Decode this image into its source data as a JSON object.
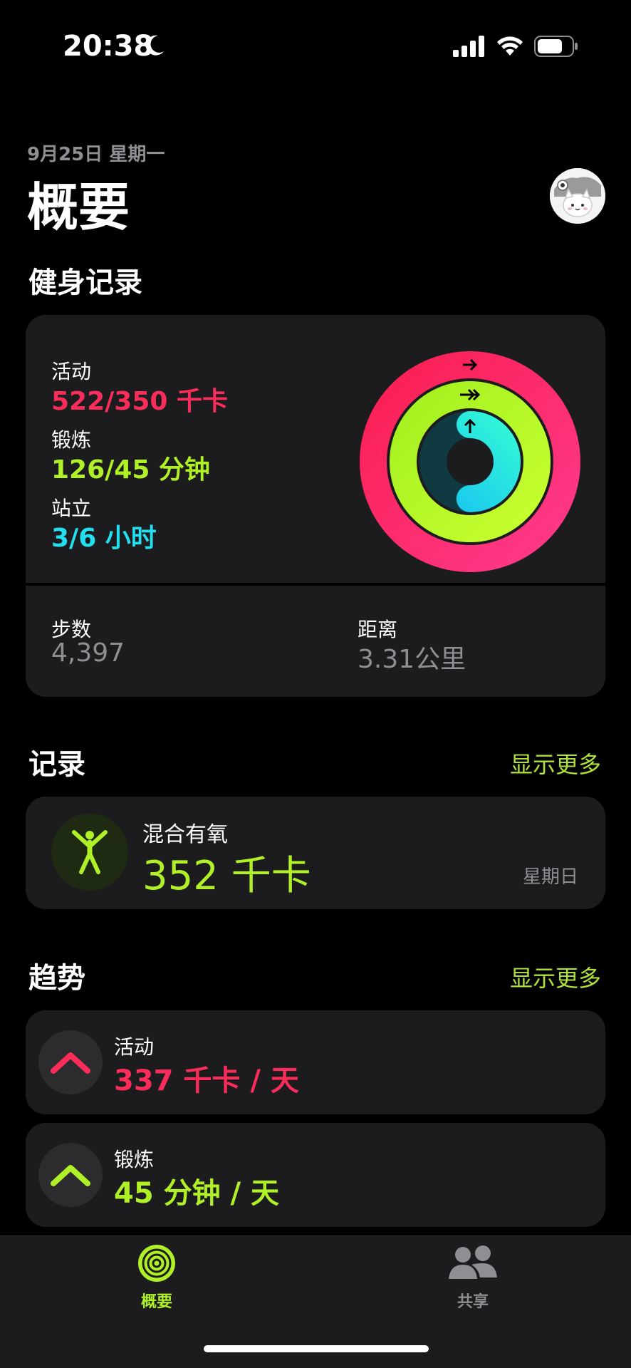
{
  "status_bar": {
    "time": "20:38"
  },
  "header": {
    "date": "9月25日 星期一",
    "title": "概要"
  },
  "fitness": {
    "section_title": "健身记录",
    "move": {
      "label": "活动",
      "value": "522/350 千卡",
      "color": "#fa2d5a",
      "progress": 1.49
    },
    "exercise": {
      "label": "锻炼",
      "value": "126/45 分钟",
      "color": "#b0f026",
      "progress": 2.8
    },
    "stand": {
      "label": "站立",
      "value": "3/6 小时",
      "color": "#23e0f0",
      "progress": 0.5
    },
    "steps": {
      "label": "步数",
      "value": "4,397"
    },
    "distance": {
      "label": "距离",
      "value": "3.31公里"
    }
  },
  "records": {
    "section_title": "记录",
    "show_more": "显示更多",
    "workout": {
      "name": "混合有氧",
      "value": "352 千卡",
      "day": "星期日"
    }
  },
  "trends": {
    "section_title": "趋势",
    "show_more": "显示更多",
    "items": [
      {
        "label": "活动",
        "value": "337 千卡 / 天",
        "color": "#fa2d5a"
      },
      {
        "label": "锻炼",
        "value": "45 分钟 / 天",
        "color": "#b0f026"
      }
    ]
  },
  "tab_bar": {
    "summary": {
      "label": "概要",
      "color": "#b0f026"
    },
    "sharing": {
      "label": "共享",
      "color": "#8e8e93"
    }
  }
}
